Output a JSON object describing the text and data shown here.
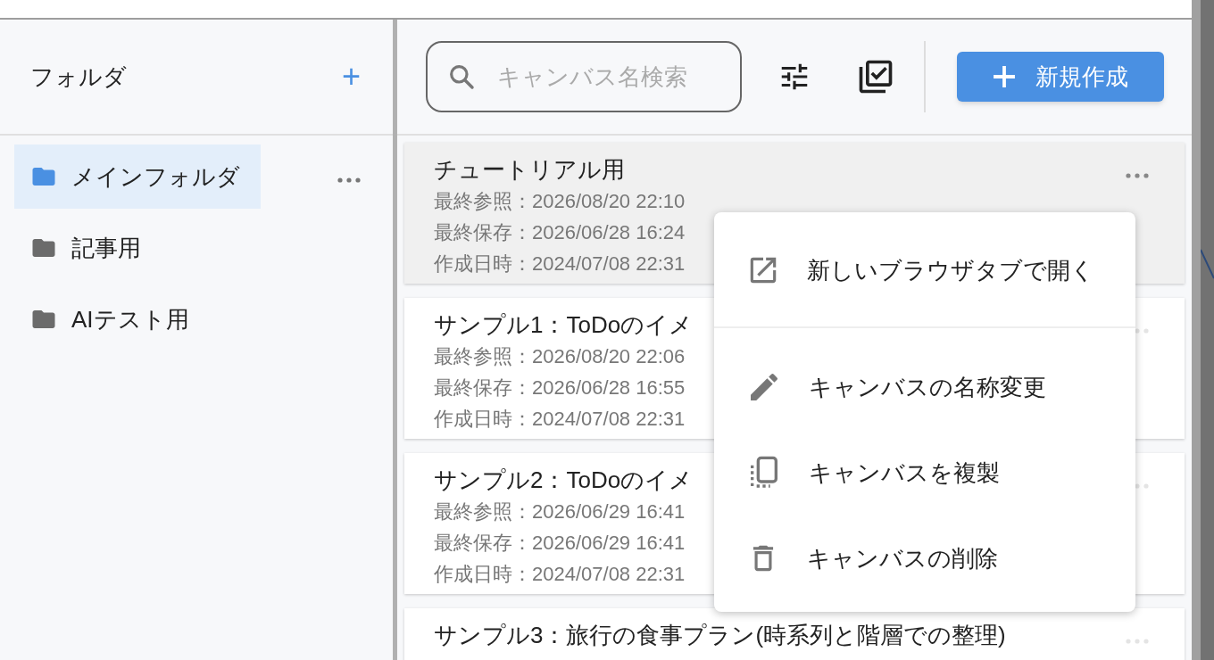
{
  "sidebar": {
    "title": "フォルダ",
    "add_icon": "+",
    "folders": [
      {
        "name": "メインフォルダ",
        "selected": true
      },
      {
        "name": "記事用",
        "selected": false
      },
      {
        "name": "AIテスト用",
        "selected": false
      }
    ]
  },
  "toolbar": {
    "search": {
      "placeholder": "キャンバス名検索"
    },
    "new_button": "新規作成"
  },
  "canvases": [
    {
      "title": "チュートリアル用",
      "lines": [
        "最終参照：2026/08/20 22:10",
        "最終保存：2026/06/28 16:24",
        "作成日時：2024/07/08 22:31"
      ],
      "selected": true
    },
    {
      "title": "サンプル1：ToDoのイメ",
      "lines": [
        "最終参照：2026/08/20 22:06",
        "最終保存：2026/06/28 16:55",
        "作成日時：2024/07/08 22:31"
      ],
      "selected": false
    },
    {
      "title": "サンプル2：ToDoのイメ",
      "lines": [
        "最終参照：2026/06/29 16:41",
        "最終保存：2026/06/29 16:41",
        "作成日時：2024/07/08 22:31"
      ],
      "selected": false
    },
    {
      "title": "サンプル3：旅行の食事プラン(時系列と階層での整理)",
      "selected": false
    }
  ],
  "context_menu": [
    {
      "kind": "open",
      "label": "新しいブラウザタブで開く"
    },
    {
      "kind": "rename",
      "label": "キャンバスの名称変更"
    },
    {
      "kind": "duplicate",
      "label": "キャンバスを複製"
    },
    {
      "kind": "delete",
      "label": "キャンバスの削除"
    }
  ]
}
